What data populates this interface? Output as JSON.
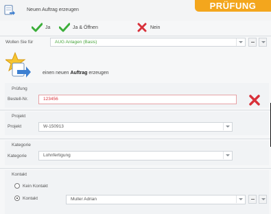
{
  "window": {
    "title": "Neuen Auftrag erzeugen"
  },
  "badge": {
    "text": "PRÜFUNG"
  },
  "toolbar": {
    "ja_label": "Ja",
    "ja_oeffnen_label": "Ja & Öffnen",
    "nein_label": "Nein"
  },
  "wollen": {
    "label": "Wollen Sie für",
    "value": "AUG Anlagen (Basis)"
  },
  "heading": {
    "prefix": "einen neuen",
    "strong": "Auftrag",
    "suffix": "erzeugen"
  },
  "pruefung": {
    "section_title": "Prüfung",
    "bestell_label": "Bestell-Nr.",
    "bestell_value": "123456"
  },
  "projekt": {
    "section_title": "Projekt",
    "label": "Projekt",
    "value": "W-150913"
  },
  "kategorie": {
    "section_title": "Kategorie",
    "label": "Kategorie",
    "value": "Lohnfertigung"
  },
  "kontakt": {
    "section_title": "Kontakt",
    "option_none": "Kein Kontakt",
    "option_contact": "Kontakt",
    "contact_value": "Muller Adrian"
  },
  "colors": {
    "accent_badge": "#f3a61d",
    "error_red": "#d8313a",
    "check_green": "#3cae3a"
  }
}
